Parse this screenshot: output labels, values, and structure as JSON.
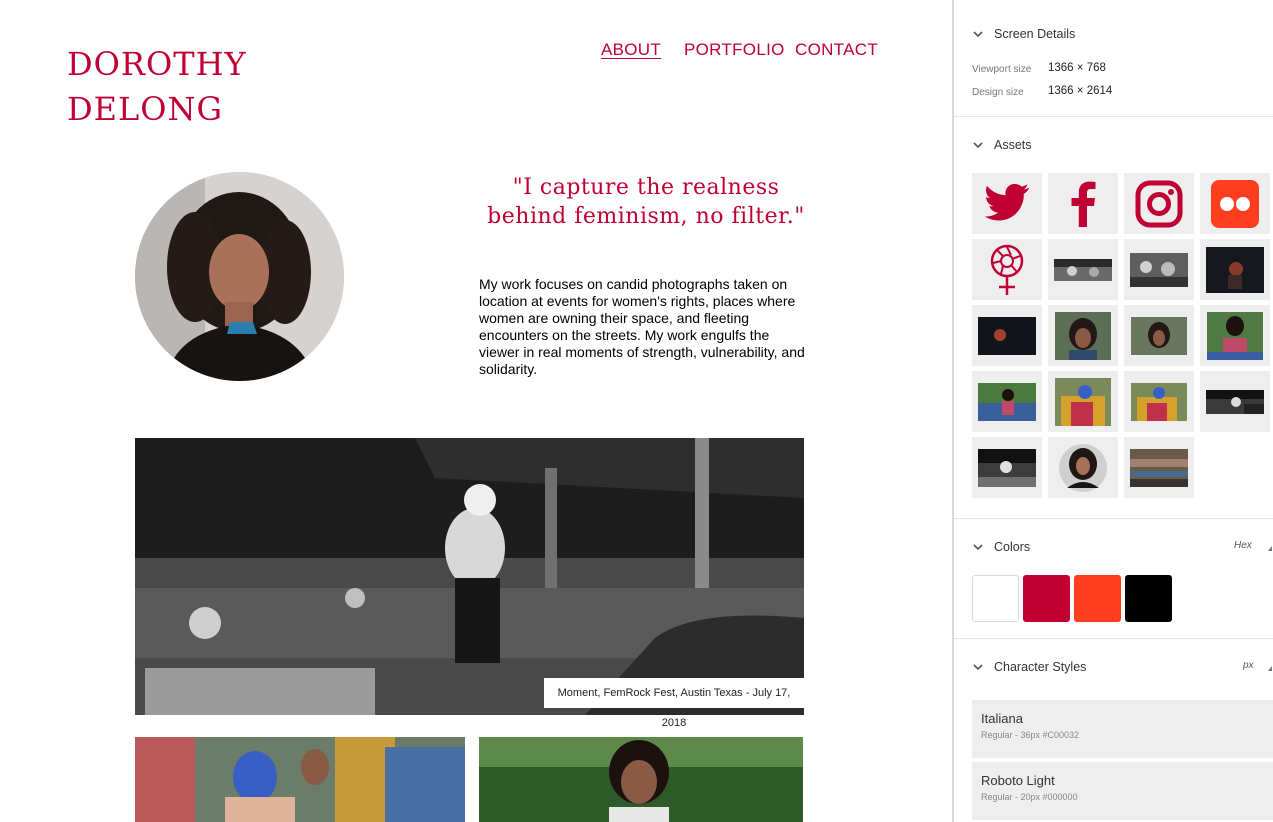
{
  "site": {
    "title_line1": "DOROTHY",
    "title_line2": "DELONG",
    "nav": [
      "ABOUT",
      "PORTFOLIO",
      "CONTACT"
    ],
    "quote": "\"I capture the realness behind feminism, no filter.\"",
    "bio": "My work focuses on candid photographs taken on location at events for women's rights, places where women are owning their space, and fleeting encounters on the streets. My work engulfs the viewer in real moments of strength, vulnerability, and solidarity.",
    "hero_caption": "Moment, FemRock Fest, Austin Texas - July 17, 2018"
  },
  "panel": {
    "screen_details": {
      "heading": "Screen Details",
      "viewport_label": "Viewport size",
      "viewport_value": "1366 × 768",
      "design_label": "Design size",
      "design_value": "1366 × 2614"
    },
    "assets": {
      "heading": "Assets",
      "icons": [
        "twitter-icon",
        "facebook-icon",
        "instagram-icon",
        "flickr-icon",
        "feminism-symbol-icon"
      ]
    },
    "colors": {
      "heading": "Colors",
      "format": "Hex",
      "swatches": [
        "#FFFFFF",
        "#C00032",
        "#FF3E1F",
        "#000000"
      ]
    },
    "character_styles": {
      "heading": "Character Styles",
      "unit": "px",
      "styles": [
        {
          "name": "Italiana",
          "meta": "Regular - 36px #C00032"
        },
        {
          "name": "Roboto Light",
          "meta": "Regular - 20px #000000"
        }
      ]
    }
  }
}
